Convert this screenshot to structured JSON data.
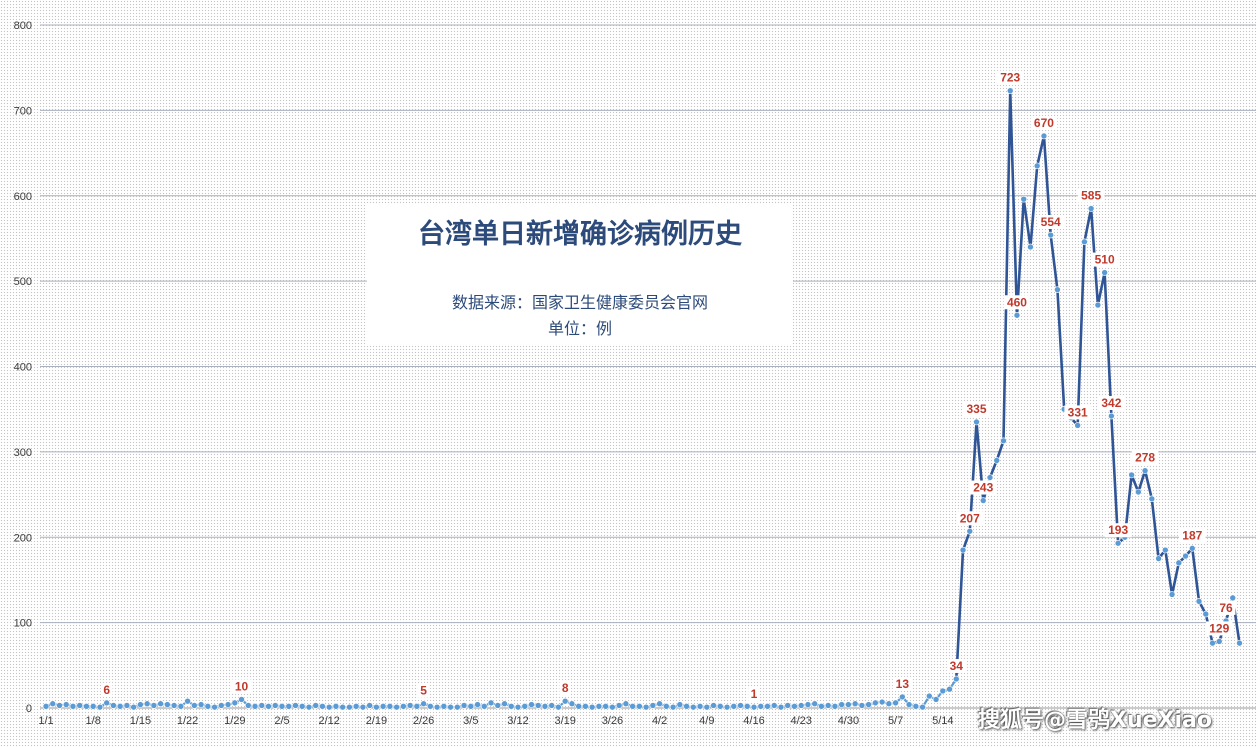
{
  "title_box": {
    "title": "台湾单日新增确诊病例历史",
    "source": "数据来源：国家卫生健康委员会官网",
    "unit": "单位：例"
  },
  "watermark": "搜狐号@雪鸮XueXiao",
  "chart_data": {
    "type": "line",
    "title": "台湾单日新增确诊病例历史",
    "ylim": [
      0,
      800
    ],
    "yticks": [
      0,
      100,
      200,
      300,
      400,
      500,
      600,
      700,
      800
    ],
    "xlim_day": [
      1,
      176
    ],
    "xticks": [
      {
        "day": 1,
        "label": "1/1"
      },
      {
        "day": 8,
        "label": "1/8"
      },
      {
        "day": 15,
        "label": "1/15"
      },
      {
        "day": 22,
        "label": "1/22"
      },
      {
        "day": 29,
        "label": "1/29"
      },
      {
        "day": 36,
        "label": "2/5"
      },
      {
        "day": 43,
        "label": "2/12"
      },
      {
        "day": 50,
        "label": "2/19"
      },
      {
        "day": 57,
        "label": "2/26"
      },
      {
        "day": 64,
        "label": "3/5"
      },
      {
        "day": 71,
        "label": "3/12"
      },
      {
        "day": 78,
        "label": "3/19"
      },
      {
        "day": 85,
        "label": "3/26"
      },
      {
        "day": 92,
        "label": "4/2"
      },
      {
        "day": 99,
        "label": "4/9"
      },
      {
        "day": 106,
        "label": "4/16"
      },
      {
        "day": 113,
        "label": "4/23"
      },
      {
        "day": 120,
        "label": "4/30"
      },
      {
        "day": 127,
        "label": "5/7"
      },
      {
        "day": 134,
        "label": "5/14"
      }
    ],
    "grid": true,
    "series": [
      {
        "color_early": "#5b9bd5",
        "color_late": "#2f5597",
        "values": [
          2,
          5,
          3,
          4,
          2,
          3,
          2,
          2,
          1,
          6,
          3,
          2,
          3,
          1,
          4,
          5,
          3,
          5,
          4,
          3,
          2,
          8,
          3,
          4,
          2,
          1,
          3,
          4,
          6,
          10,
          3,
          2,
          3,
          2,
          3,
          2,
          2,
          3,
          2,
          1,
          3,
          2,
          1,
          2,
          1,
          1,
          2,
          1,
          3,
          1,
          2,
          2,
          1,
          2,
          3,
          2,
          5,
          2,
          1,
          2,
          1,
          1,
          3,
          2,
          4,
          2,
          6,
          3,
          5,
          2,
          1,
          2,
          4,
          3,
          2,
          3,
          1,
          8,
          5,
          2,
          2,
          1,
          2,
          2,
          1,
          3,
          5,
          2,
          2,
          1,
          3,
          5,
          2,
          1,
          4,
          2,
          1,
          2,
          1,
          3,
          2,
          1,
          2,
          3,
          2,
          1,
          2,
          2,
          3,
          1,
          3,
          2,
          3,
          4,
          5,
          2,
          3,
          2,
          4,
          4,
          5,
          3,
          4,
          6,
          7,
          5,
          6,
          13,
          4,
          2,
          1,
          14,
          10,
          20,
          22,
          34,
          185,
          207,
          335,
          243,
          270,
          290,
          313,
          723,
          460,
          596,
          540,
          635,
          670,
          554,
          490,
          350,
          340,
          331,
          546,
          585,
          472,
          510,
          342,
          193,
          200,
          273,
          253,
          278,
          245,
          175,
          185,
          133,
          170,
          178,
          187,
          125,
          110,
          76,
          78,
          102,
          129,
          76
        ]
      }
    ],
    "data_labels": [
      {
        "day": 10,
        "text": "6"
      },
      {
        "day": 30,
        "text": "10"
      },
      {
        "day": 57,
        "text": "5"
      },
      {
        "day": 78,
        "text": "8"
      },
      {
        "day": 106,
        "text": "1"
      },
      {
        "day": 128,
        "text": "13"
      },
      {
        "day": 136,
        "text": "34"
      },
      {
        "day": 138,
        "text": "207"
      },
      {
        "day": 139,
        "text": "335"
      },
      {
        "day": 140,
        "text": "243"
      },
      {
        "day": 144,
        "text": "723"
      },
      {
        "day": 145,
        "text": "460"
      },
      {
        "day": 149,
        "text": "670"
      },
      {
        "day": 150,
        "text": "554"
      },
      {
        "day": 154,
        "text": "331"
      },
      {
        "day": 156,
        "text": "585"
      },
      {
        "day": 158,
        "text": "510"
      },
      {
        "day": 159,
        "text": "342"
      },
      {
        "day": 160,
        "text": "193"
      },
      {
        "day": 164,
        "text": "278"
      },
      {
        "day": 171,
        "text": "187"
      },
      {
        "day": 175,
        "text": "129"
      },
      {
        "day": 176,
        "text": "76"
      }
    ]
  }
}
